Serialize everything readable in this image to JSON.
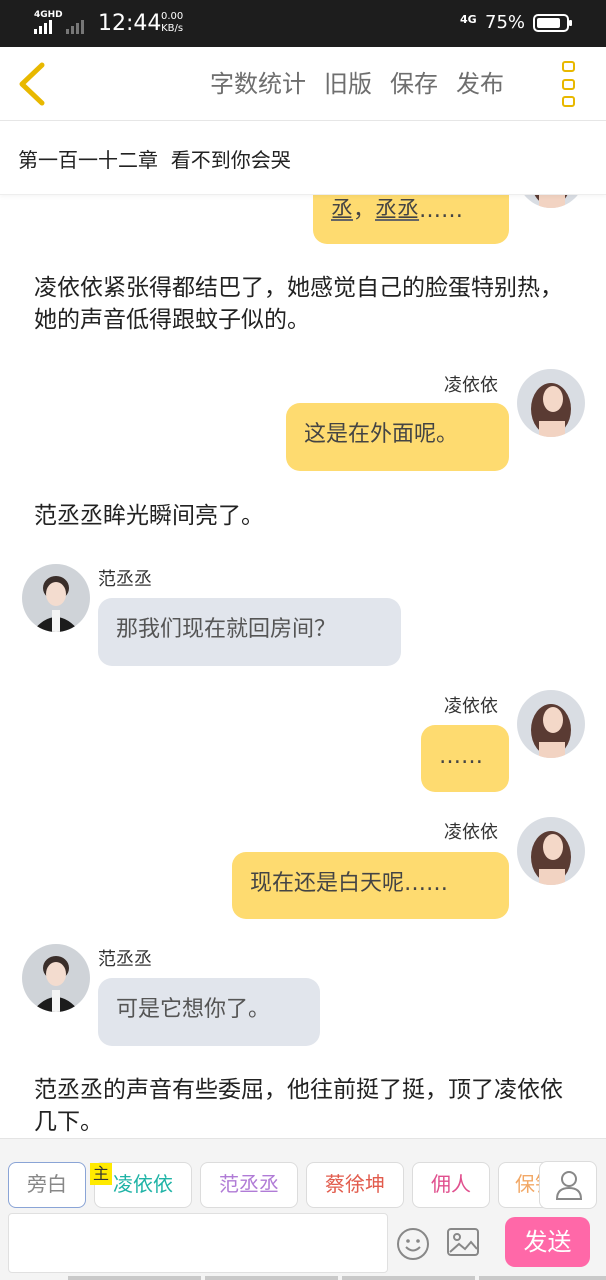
{
  "status_bar": {
    "network": "4GHD",
    "time": "12:44",
    "speed_value": "0.00",
    "speed_unit": "KB/s",
    "network2": "4G",
    "battery": "75%"
  },
  "nav": {
    "word_count": "字数统计",
    "old_version": "旧版",
    "save": "保存",
    "publish": "发布"
  },
  "chapter_title": "第一百一十二章  看不到你会哭",
  "messages": {
    "m0_pre": "丞",
    "m0_mid": "，",
    "m0_name": "丞丞",
    "m0_post": "……",
    "narr1": "凌依依紧张得都结巴了，她感觉自己的脸蛋特别热，她的声音低得跟蚊子似的。",
    "m1_speaker": "凌依依",
    "m1_text": "这是在外面呢。",
    "narr2": "范丞丞眸光瞬间亮了。",
    "m2_speaker": "范丞丞",
    "m2_text": "那我们现在就回房间？",
    "m3_speaker": "凌依依",
    "m3_text": "……",
    "m4_speaker": "凌依依",
    "m4_text": "现在还是白天呢……",
    "m5_speaker": "范丞丞",
    "m5_text": "可是它想你了。",
    "narr3": "范丞丞的声音有些委屈，他往前挺了挺，顶了凌依依几下。"
  },
  "role_chips": {
    "main_badge": "主",
    "items": [
      {
        "label": "旁白",
        "color": "#888888"
      },
      {
        "label": "凌依依",
        "color": "#1fb3a6"
      },
      {
        "label": "范丞丞",
        "color": "#b07bd6"
      },
      {
        "label": "蔡徐坤",
        "color": "#e25c4d"
      },
      {
        "label": "佣人",
        "color": "#e0508e"
      },
      {
        "label": "保镖",
        "color": "#f2a866"
      }
    ]
  },
  "input": {
    "value": ""
  },
  "send_label": "发送",
  "icons": {
    "back": "chevron-left-icon",
    "more": "more-vertical-icon",
    "emoji": "smiley-icon",
    "image": "image-icon",
    "profile": "user-icon"
  },
  "colors": {
    "accent_yellow": "#e8b800",
    "bubble_yellow": "#fedb70",
    "bubble_gray": "#e1e5ec",
    "send_pink": "#ff68a8"
  }
}
